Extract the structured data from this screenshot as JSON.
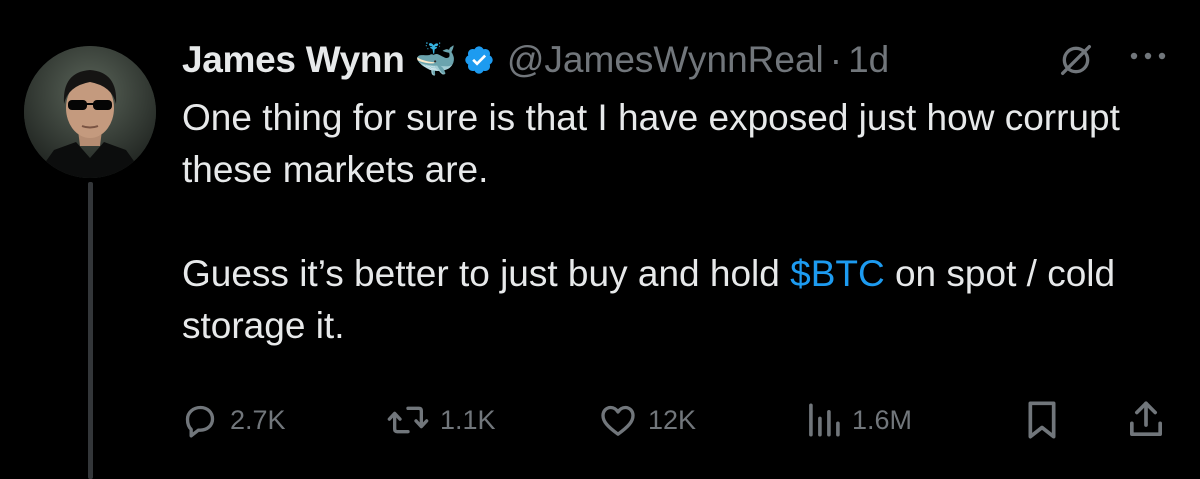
{
  "author": {
    "display_name": "James Wynn",
    "badge_emoji": "🐳",
    "verified": true,
    "handle": "@JamesWynnReal",
    "separator": "·",
    "timestamp": "1d",
    "avatar_icon": "avatar-photo"
  },
  "tweet": {
    "line1": "One thing for sure is that I have exposed just how corrupt these markets are.",
    "line2_prefix": "Guess it’s better to just buy and hold ",
    "cashtag": "$BTC",
    "line2_suffix": " on spot / cold storage it."
  },
  "actions": {
    "replies": "2.7K",
    "reposts": "1.1K",
    "likes": "12K",
    "views": "1.6M"
  },
  "colors": {
    "background": "#000000",
    "text": "#e7e9ea",
    "muted": "#71767b",
    "accent": "#1d9bf0"
  }
}
